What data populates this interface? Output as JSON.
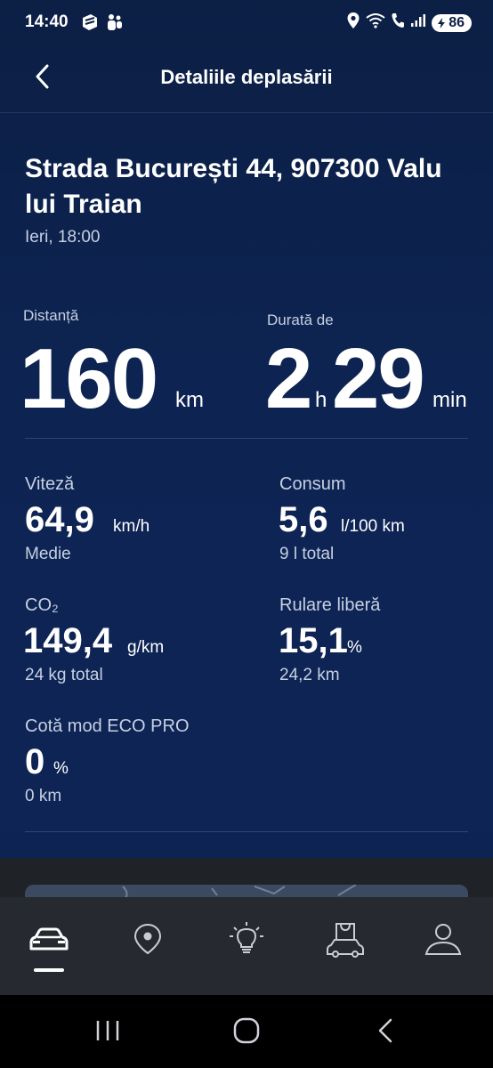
{
  "status_bar": {
    "time": "14:40",
    "battery": "86",
    "icons": [
      "gallery-icon",
      "teams-icon",
      "location-icon",
      "wifi-icon",
      "call-icon",
      "signal-icon",
      "battery-icon"
    ]
  },
  "header": {
    "title": "Detaliile deplasării",
    "back_icon": "chevron-left-icon"
  },
  "trip": {
    "address": "Strada București 44, 907300 Valu lui Traian",
    "when": "Ieri, 18:00"
  },
  "summary": {
    "distance": {
      "label": "Distanță",
      "value": "160",
      "unit": "km"
    },
    "duration": {
      "label": "Durată de",
      "hours": "2",
      "hours_unit": "h",
      "minutes": "29",
      "minutes_unit": "min"
    }
  },
  "stats": {
    "speed": {
      "label": "Viteză",
      "value": "64,9",
      "unit": "km/h",
      "sub": "Medie"
    },
    "consumption": {
      "label": "Consum",
      "value": "5,6",
      "unit": "l/100 km",
      "sub": "9 l total"
    },
    "co2": {
      "label": "CO₂",
      "value": "149,4",
      "unit": "g/km",
      "sub": "24 kg total"
    },
    "coasting": {
      "label": "Rulare liberă",
      "value": "15,1",
      "unit": "%",
      "sub": "24,2 km"
    },
    "eco_pro": {
      "label": "Cotă mod ECO PRO",
      "value": "0",
      "unit": "%",
      "sub": "0 km"
    }
  },
  "bottom_nav": [
    {
      "icon": "car-icon",
      "active": true
    },
    {
      "icon": "map-pin-icon",
      "active": false
    },
    {
      "icon": "lightbulb-icon",
      "active": false
    },
    {
      "icon": "shop-car-icon",
      "active": false
    },
    {
      "icon": "profile-icon",
      "active": false
    }
  ],
  "system_nav": [
    "recents-icon",
    "home-icon",
    "back-icon"
  ],
  "colors": {
    "background": "#0d2453",
    "text": "#ffffff",
    "muted_text": "#c7d0e2",
    "nav_background": "#262a30"
  }
}
